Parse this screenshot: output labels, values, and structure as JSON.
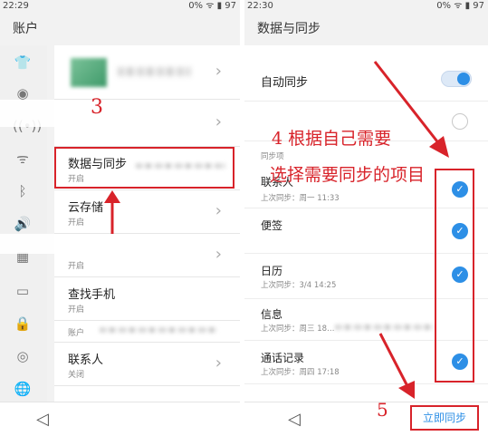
{
  "left": {
    "status": {
      "time": "22:29",
      "battery": "0%",
      "level": "97"
    },
    "title": "账户",
    "rows": [
      {
        "title": "",
        "sub": ""
      },
      {
        "title": "",
        "sub": ""
      },
      {
        "title": "数据与同步",
        "sub": "开启"
      },
      {
        "title": "云存储",
        "sub": "开启"
      },
      {
        "title": "",
        "sub": "开启"
      },
      {
        "title": "查找手机",
        "sub": "开启"
      },
      {
        "title": "",
        "sub": "账户"
      },
      {
        "title": "联系人",
        "sub": "关闭"
      },
      {
        "title": "",
        "sub": ""
      }
    ],
    "annotation": "3"
  },
  "right": {
    "status": {
      "time": "22:30",
      "battery": "0%",
      "level": "97"
    },
    "title": "数据与同步",
    "auto_sync": "自动同步",
    "auto_sync_on": true,
    "section_label": "同步项",
    "items": [
      {
        "title": "联系人",
        "sub": "上次同步：周一 11:33",
        "checked": true
      },
      {
        "title": "便签",
        "sub": "",
        "checked": true
      },
      {
        "title": "日历",
        "sub": "上次同步：3/4 14:25",
        "checked": true
      },
      {
        "title": "信息",
        "sub": "上次同步：周三 18…",
        "checked": false
      },
      {
        "title": "通话记录",
        "sub": "上次同步：周四 17:18",
        "checked": true
      }
    ],
    "sync_now": "立即同步",
    "annotation_4": "4 根据自己需要",
    "annotation_4b": "选择需要同步的项目",
    "annotation_5": "5"
  },
  "colors": {
    "accent": "#2d8fe6",
    "annotation": "#d8232a"
  }
}
